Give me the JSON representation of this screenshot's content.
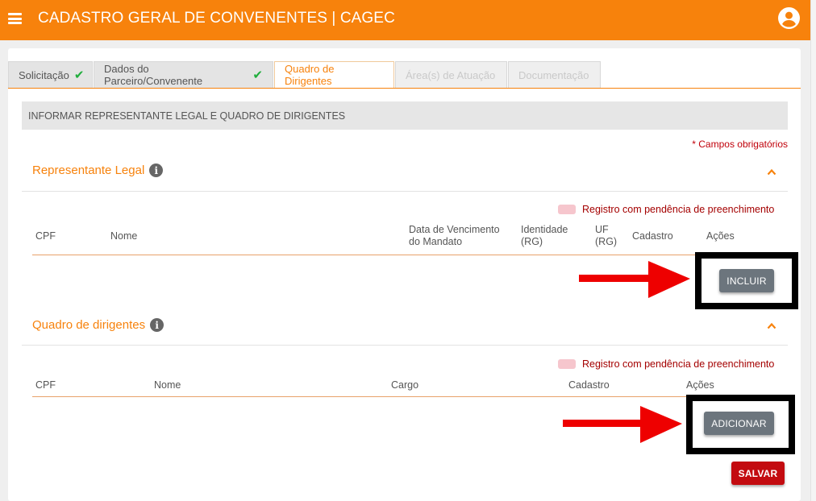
{
  "header": {
    "title": "CADASTRO GERAL DE CONVENENTES | CAGEC",
    "menu_icon": "hamburger-menu-icon",
    "user_icon": "account-circle-icon",
    "accent_color": "#f7820c"
  },
  "tabs": [
    {
      "label": "Solicitação",
      "completed": true,
      "state": "done"
    },
    {
      "label": "Dados do Parceiro/Convenente",
      "completed": true,
      "state": "done"
    },
    {
      "label": "Quadro de Dirigentes",
      "completed": false,
      "state": "active"
    },
    {
      "label": "Área(s) de Atuação",
      "completed": false,
      "state": "disabled"
    },
    {
      "label": "Documentação",
      "completed": false,
      "state": "disabled"
    }
  ],
  "banner": "INFORMAR REPRESENTANTE LEGAL E QUADRO DE DIRIGENTES",
  "required_note": "* Campos obrigatórios",
  "legal_rep": {
    "title": "Representante Legal",
    "legend": "Registro com pendência de preenchimento",
    "columns": {
      "cpf": "CPF",
      "nome": "Nome",
      "vencimento": "Data de Vencimento do Mandato",
      "identidade": "Identidade (RG)",
      "uf": "UF (RG)",
      "cadastro": "Cadastro",
      "acoes": "Ações"
    },
    "add_button": "INCLUIR"
  },
  "directors": {
    "title": "Quadro de dirigentes",
    "legend": "Registro com pendência de preenchimento",
    "columns": {
      "cpf": "CPF",
      "nome": "Nome",
      "cargo": "Cargo",
      "cadastro": "Cadastro",
      "acoes": "Ações"
    },
    "add_button": "ADICIONAR"
  },
  "save_button": "SALVAR",
  "colors": {
    "pending_swatch": "#f6c6cd",
    "save_button": "#c30b10",
    "secondary_button": "#6c757d",
    "annotation_arrow": "#ee0000"
  }
}
